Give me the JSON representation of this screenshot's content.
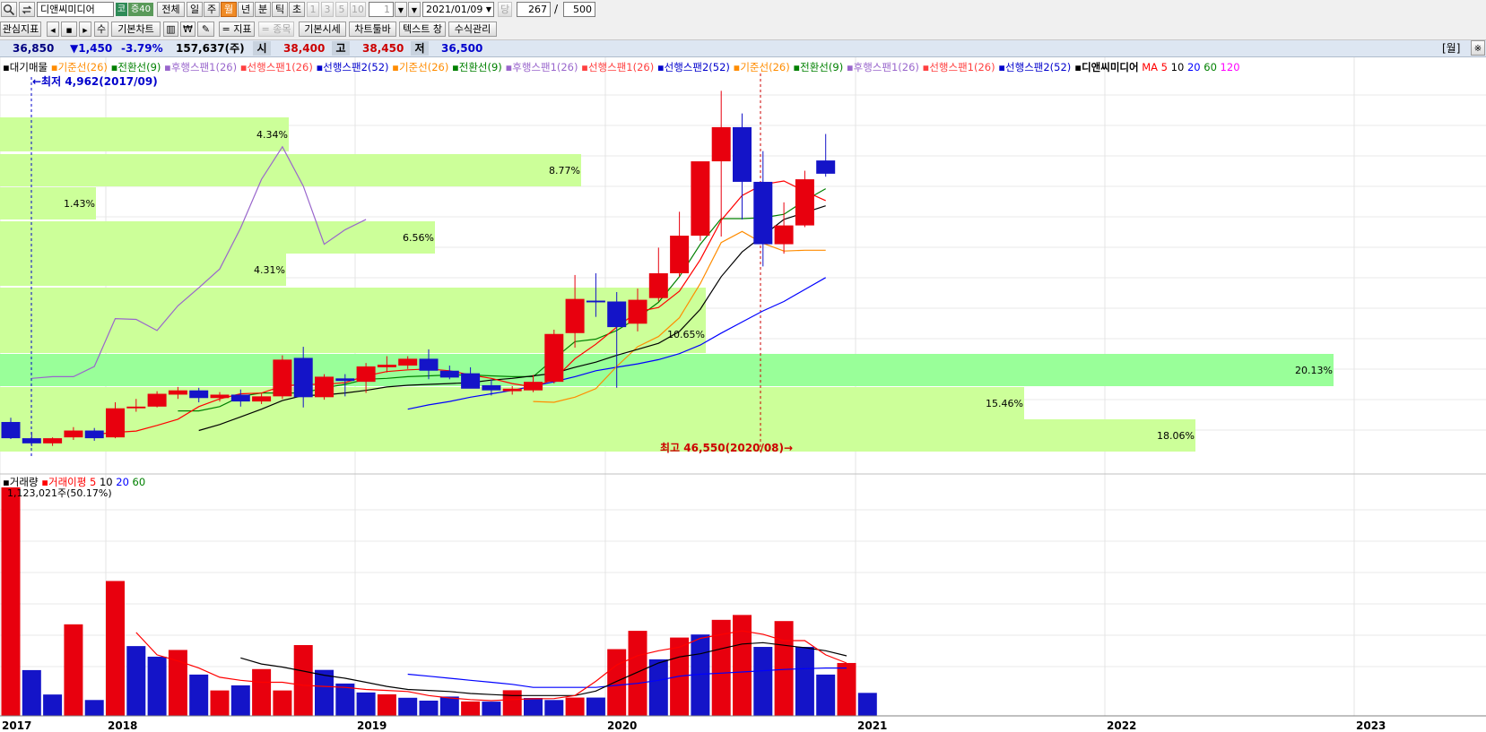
{
  "toolbar": {
    "stock_name": "디앤씨미디어",
    "market_badge": "코",
    "margin_badge": "증40",
    "period_buttons": [
      "전체",
      "일",
      "주",
      "월",
      "년",
      "분",
      "틱",
      "초"
    ],
    "active_period": "월",
    "interval_buttons": [
      "1",
      "3",
      "5",
      "10"
    ],
    "interval_select": "1",
    "date": "2021/01/09",
    "when_label": "당",
    "count": "267",
    "count_sep": "/",
    "total": "500"
  },
  "toolbar2": {
    "interest_label": "관심지표",
    "number_label": "수",
    "basic_chart": "기본차트",
    "won_label": "₩",
    "indicator_label": "= 지표",
    "item_label": "= 종목",
    "basic_quote": "기본시세",
    "chart_toolbar": "차트툴바",
    "text_window": "텍스트 창",
    "formula_manage": "수식관리"
  },
  "info": {
    "price": "36,850",
    "change": "▼1,450",
    "change_pct": "-3.79%",
    "volume": "157,637(주)",
    "open_label": "시",
    "open": "38,400",
    "high_label": "고",
    "high": "38,450",
    "low_label": "저",
    "low": "36,500",
    "period_tag": "[월]"
  },
  "colors": {
    "up": "#e8000e",
    "down": "#1414c8",
    "volume_profile": "#ccff99",
    "volume_profile_max": "#99ff99",
    "background": "#ffffff",
    "ichimoku_base": "#ff8c00",
    "ichimoku_conv": "#008000",
    "lagging_span": "#9966cc",
    "leading_span1": "#ff4040",
    "leading_span2": "#0000cc",
    "ma5": "#ff0000",
    "ma10": "#000000",
    "ma20": "#0000ff",
    "ma60": "#008000",
    "ma120": "#ff00ff"
  },
  "price_legend": [
    {
      "text": "대기매물",
      "color": "#000000"
    },
    {
      "text": "기준선(26)",
      "color": "#ff8c00"
    },
    {
      "text": "전환선(9)",
      "color": "#008000"
    },
    {
      "text": "후행스팬1(26)",
      "color": "#9966cc"
    },
    {
      "text": "선행스팬1(26)",
      "color": "#ff4040"
    },
    {
      "text": "선행스팬2(52)",
      "color": "#0000cc"
    },
    {
      "text": "기준선(26)",
      "color": "#ff8c00"
    },
    {
      "text": "전환선(9)",
      "color": "#008000"
    },
    {
      "text": "후행스팬1(26)",
      "color": "#9966cc"
    },
    {
      "text": "선행스팬1(26)",
      "color": "#ff4040"
    },
    {
      "text": "선행스팬2(52)",
      "color": "#0000cc"
    },
    {
      "text": "기준선(26)",
      "color": "#ff8c00"
    },
    {
      "text": "전환선(9)",
      "color": "#008000"
    },
    {
      "text": "후행스팬1(26)",
      "color": "#9966cc"
    },
    {
      "text": "선행스팬1(26)",
      "color": "#ff4040"
    },
    {
      "text": "선행스팬2(52)",
      "color": "#0000cc"
    },
    {
      "text": "디앤씨미디어",
      "color": "#000000",
      "bold": true
    },
    {
      "text": "MA",
      "color": "#ff0000"
    },
    {
      "text": "5",
      "color": "#ff0000"
    },
    {
      "text": "10",
      "color": "#000000"
    },
    {
      "text": "20",
      "color": "#0000ff"
    },
    {
      "text": "60",
      "color": "#008000"
    },
    {
      "text": "120",
      "color": "#ff00ff"
    }
  ],
  "volume_legend": [
    {
      "text": "거래량",
      "color": "#000000"
    },
    {
      "text": "거래이평",
      "color": "#ff0000"
    },
    {
      "text": "5",
      "color": "#ff0000"
    },
    {
      "text": "10",
      "color": "#000000"
    },
    {
      "text": "20",
      "color": "#0000ff"
    },
    {
      "text": "60",
      "color": "#008000"
    }
  ],
  "annotations": {
    "lowest": "←최저 4,962(2017/09)",
    "highest": "최고 46,550(2020/08)→",
    "volume_max": "1,123,021주(50.17%)"
  },
  "chart_data": [
    {
      "type": "candlestick",
      "title": "디앤씨미디어",
      "period": "월",
      "x_axis_labels": [
        "2017",
        "2018",
        "2019",
        "2020",
        "2021",
        "2022",
        "2023"
      ],
      "ylim": [
        3500,
        49000
      ],
      "candles": [
        {
          "o": 7800,
          "h": 8300,
          "l": 5800,
          "c": 5900
        },
        {
          "o": 5900,
          "h": 6600,
          "l": 4962,
          "c": 5300
        },
        {
          "o": 5300,
          "h": 6000,
          "l": 5000,
          "c": 5900
        },
        {
          "o": 6000,
          "h": 7200,
          "l": 5700,
          "c": 6800
        },
        {
          "o": 6800,
          "h": 7100,
          "l": 5600,
          "c": 5900
        },
        {
          "o": 6000,
          "h": 10100,
          "l": 5900,
          "c": 9400
        },
        {
          "o": 9400,
          "h": 10500,
          "l": 9000,
          "c": 9600
        },
        {
          "o": 9600,
          "h": 11400,
          "l": 9500,
          "c": 11100
        },
        {
          "o": 11000,
          "h": 11900,
          "l": 10500,
          "c": 11500
        },
        {
          "o": 11500,
          "h": 11800,
          "l": 10100,
          "c": 10600
        },
        {
          "o": 10600,
          "h": 11300,
          "l": 10200,
          "c": 11000
        },
        {
          "o": 11000,
          "h": 11600,
          "l": 9600,
          "c": 10200
        },
        {
          "o": 10200,
          "h": 11100,
          "l": 9900,
          "c": 10800
        },
        {
          "o": 10800,
          "h": 15600,
          "l": 10500,
          "c": 15100
        },
        {
          "o": 15300,
          "h": 16600,
          "l": 9500,
          "c": 10700
        },
        {
          "o": 10700,
          "h": 13400,
          "l": 10400,
          "c": 13100
        },
        {
          "o": 12900,
          "h": 13400,
          "l": 10800,
          "c": 12600
        },
        {
          "o": 12500,
          "h": 14700,
          "l": 11200,
          "c": 14300
        },
        {
          "o": 14200,
          "h": 15500,
          "l": 13600,
          "c": 14500
        },
        {
          "o": 14400,
          "h": 15500,
          "l": 14000,
          "c": 15200
        },
        {
          "o": 15200,
          "h": 16300,
          "l": 12800,
          "c": 13800
        },
        {
          "o": 13800,
          "h": 14400,
          "l": 12800,
          "c": 13000
        },
        {
          "o": 13500,
          "h": 14200,
          "l": 12100,
          "c": 11700
        },
        {
          "o": 12100,
          "h": 12800,
          "l": 10900,
          "c": 11500
        },
        {
          "o": 11400,
          "h": 12000,
          "l": 11000,
          "c": 11700
        },
        {
          "o": 11500,
          "h": 13300,
          "l": 11300,
          "c": 12500
        },
        {
          "o": 12500,
          "h": 18600,
          "l": 12300,
          "c": 18100
        },
        {
          "o": 18200,
          "h": 25000,
          "l": 16500,
          "c": 22200
        },
        {
          "o": 22000,
          "h": 25200,
          "l": 20100,
          "c": 21800
        },
        {
          "o": 21900,
          "h": 23000,
          "l": 11800,
          "c": 18900
        },
        {
          "o": 19300,
          "h": 23400,
          "l": 18400,
          "c": 22100
        },
        {
          "o": 22300,
          "h": 28200,
          "l": 21900,
          "c": 25200
        },
        {
          "o": 25200,
          "h": 32400,
          "l": 24800,
          "c": 29600
        },
        {
          "o": 29600,
          "h": 37000,
          "l": 29000,
          "c": 38300
        },
        {
          "o": 38300,
          "h": 46550,
          "l": 29500,
          "c": 42300
        },
        {
          "o": 42300,
          "h": 43900,
          "l": 31500,
          "c": 35900
        },
        {
          "o": 35900,
          "h": 39500,
          "l": 26000,
          "c": 28600
        },
        {
          "o": 28600,
          "h": 33500,
          "l": 27500,
          "c": 30800
        },
        {
          "o": 30800,
          "h": 37200,
          "l": 30600,
          "c": 36200
        },
        {
          "o": 38400,
          "h": 41500,
          "l": 36500,
          "c": 36850
        }
      ],
      "ma5": [
        null,
        null,
        null,
        null,
        6340,
        6580,
        6740,
        7400,
        8120,
        9600,
        10500,
        11100,
        11180,
        12000,
        12200,
        12200,
        12400,
        13200,
        13700,
        13900,
        14000,
        13800,
        13300,
        12900,
        12300,
        11900,
        12800,
        15200,
        16900,
        18900,
        20700,
        21200,
        23100,
        26800,
        31400,
        34300,
        35600,
        36000,
        34800,
        33700
      ],
      "ma10": [
        null,
        null,
        null,
        null,
        null,
        null,
        null,
        null,
        null,
        6800,
        7500,
        8400,
        9300,
        10300,
        10900,
        10950,
        11200,
        11500,
        11900,
        12100,
        12200,
        12300,
        12400,
        12700,
        12900,
        13200,
        13500,
        14200,
        14800,
        15600,
        16300,
        17000,
        18400,
        21000,
        24800,
        27700,
        29600,
        31500,
        32300,
        33100
      ],
      "ma20": [
        null,
        null,
        null,
        null,
        null,
        null,
        null,
        null,
        null,
        null,
        null,
        null,
        null,
        null,
        null,
        null,
        null,
        null,
        null,
        9300,
        9800,
        10200,
        10700,
        11100,
        11500,
        12000,
        12500,
        13100,
        13800,
        14200,
        14600,
        15100,
        15800,
        16800,
        18200,
        19500,
        20800,
        21900,
        23300,
        24700
      ],
      "base_line": [
        null,
        null,
        null,
        null,
        null,
        null,
        null,
        null,
        null,
        null,
        null,
        null,
        null,
        null,
        null,
        null,
        null,
        null,
        null,
        null,
        null,
        null,
        null,
        null,
        null,
        10200,
        10100,
        10700,
        11700,
        14300,
        16600,
        17800,
        20000,
        24000,
        28800,
        30100,
        28700,
        27800,
        27900,
        27900
      ],
      "conversion_line": [
        null,
        null,
        null,
        null,
        null,
        null,
        null,
        null,
        9100,
        9100,
        9600,
        10800,
        11200,
        11200,
        11200,
        11800,
        12200,
        12800,
        12900,
        13100,
        13200,
        13300,
        13300,
        13200,
        13100,
        13100,
        15200,
        17200,
        17500,
        18500,
        20000,
        21800,
        24800,
        28600,
        31600,
        31600,
        31700,
        32100,
        33700,
        35100
      ],
      "lagging_span": [
        null,
        12900,
        13100,
        13100,
        14300,
        19900,
        19800,
        18500,
        21400,
        23500,
        25700,
        30500,
        36200,
        40000,
        35400,
        28600,
        30300,
        31500,
        null,
        null,
        null,
        null,
        null,
        null,
        null,
        null,
        null,
        null,
        null,
        null,
        null,
        null,
        null,
        null,
        null,
        null,
        null,
        null,
        null,
        null
      ]
    },
    {
      "type": "bar",
      "title": "거래량",
      "values": [
        1123021,
        225000,
        105000,
        450000,
        78000,
        663000,
        343000,
        291000,
        324000,
        203000,
        125000,
        150000,
        230000,
        125000,
        348000,
        226000,
        159000,
        115000,
        106000,
        89000,
        75000,
        95000,
        71000,
        70000,
        126000,
        88000,
        78000,
        90000,
        90000,
        328000,
        418000,
        278000,
        385000,
        400000,
        472000,
        496000,
        339000,
        466000,
        339000,
        203000,
        260000,
        113000
      ],
      "colors": [
        "up",
        "down",
        "down",
        "up",
        "down",
        "up",
        "down",
        "down",
        "up",
        "down",
        "up",
        "down",
        "up",
        "up",
        "up",
        "down",
        "down",
        "down",
        "up",
        "down",
        "down",
        "down",
        "up",
        "down",
        "up",
        "down",
        "down",
        "up",
        "down",
        "up",
        "up",
        "down",
        "up",
        "down",
        "up",
        "up",
        "down",
        "up",
        "down",
        "down",
        "up",
        "down"
      ],
      "ma5": [
        null,
        null,
        null,
        null,
        null,
        null,
        410000,
        300000,
        270000,
        235000,
        190000,
        175000,
        165000,
        165000,
        150000,
        145000,
        140000,
        130000,
        125000,
        120000,
        100000,
        88000,
        80000,
        75000,
        80000,
        84000,
        85000,
        100000,
        170000,
        250000,
        296000,
        320000,
        338000,
        381000,
        400000,
        418000,
        401000,
        370000,
        370000,
        300000,
        260000
      ],
      "ma10": [
        null,
        null,
        null,
        null,
        null,
        null,
        null,
        null,
        null,
        null,
        null,
        285000,
        255000,
        240000,
        220000,
        200000,
        185000,
        165000,
        145000,
        130000,
        125000,
        120000,
        110000,
        105000,
        100000,
        100000,
        100000,
        100000,
        122000,
        170000,
        215000,
        260000,
        290000,
        305000,
        330000,
        353000,
        360000,
        347000,
        335000,
        320000,
        295000
      ],
      "ma20": [
        null,
        null,
        null,
        null,
        null,
        null,
        null,
        null,
        null,
        null,
        null,
        null,
        null,
        null,
        null,
        null,
        null,
        null,
        null,
        205000,
        195000,
        185000,
        175000,
        165000,
        155000,
        140000,
        140000,
        140000,
        140000,
        150000,
        160000,
        175000,
        195000,
        205000,
        210000,
        216000,
        222000,
        228000,
        232000,
        235000,
        235000
      ]
    }
  ],
  "volume_profile": [
    {
      "pct": "4.34%"
    },
    {
      "pct": "8.77%"
    },
    {
      "pct": "1.43%"
    },
    {
      "pct": "6.56%"
    },
    {
      "pct": "4.31%"
    },
    {
      "pct": "10.65%"
    },
    {
      "pct": "20.13%"
    },
    {
      "pct": "15.46%"
    },
    {
      "pct": "18.06%"
    }
  ]
}
